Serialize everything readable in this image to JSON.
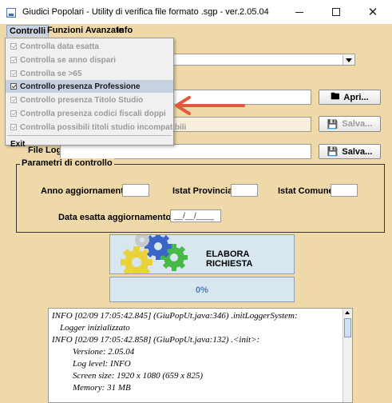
{
  "window": {
    "title": "Giudici Popolari - Utility di verifica file formato .sgp - ver.2.05.04",
    "minimize_label": "–",
    "maximize_label": "☐",
    "close_label": "✕"
  },
  "menubar": {
    "controlli": "Controlli",
    "funzioni": "Funzioni Avanzate",
    "info": "Info"
  },
  "dropdown": {
    "items": [
      {
        "label": "Controlla data esatta",
        "enabled": false
      },
      {
        "label": "Controlla se anno dispari",
        "enabled": false
      },
      {
        "label": "Controlla se >65",
        "enabled": false
      },
      {
        "label": "Controllo presenza Professione",
        "enabled": true,
        "selected": true
      },
      {
        "label": "Controllo presenza Titolo Studio",
        "enabled": false
      },
      {
        "label": "Controlla presenza codici fiscali doppi",
        "enabled": false
      },
      {
        "label": "Controlla possibili titoli studio incompatibili",
        "enabled": false
      }
    ],
    "exit": "Exit"
  },
  "buttons": {
    "apri": "Apri...",
    "salva_disabled": "Salva...",
    "salva": "Salva..."
  },
  "file_log": {
    "label": "File Log:",
    "value": ""
  },
  "parametri": {
    "title": "Parametri di controllo",
    "anno_label": "Anno aggiornamento:",
    "anno_value": "",
    "provincia_label": "Istat Provincia:",
    "provincia_value": "",
    "comune_label": "Istat Comune:",
    "comune_value": "",
    "data_label": "Data esatta aggiornamento:",
    "data_value": "__/__/____"
  },
  "elabora": {
    "label": "ELABORA RICHIESTA"
  },
  "progress": {
    "value": 0,
    "text": "0%"
  },
  "log": {
    "lines": [
      "INFO [02/09 17:05:42.845] (GiuPopUt.java:346) .initLoggerSystem:",
      "Logger inizializzato",
      "INFO [02/09 17:05:42.858] (GiuPopUt.java:132) .<init>:",
      "Versione: 2.05.04",
      "Log level: INFO",
      "Screen size: 1920 x 1080  (659 x 825)",
      "Memory: 31 MB"
    ]
  },
  "colors": {
    "background": "#efd9a8",
    "selection": "#c6d1e2",
    "arrow": "#e05a3e",
    "progress_text": "#4a7fb5"
  }
}
